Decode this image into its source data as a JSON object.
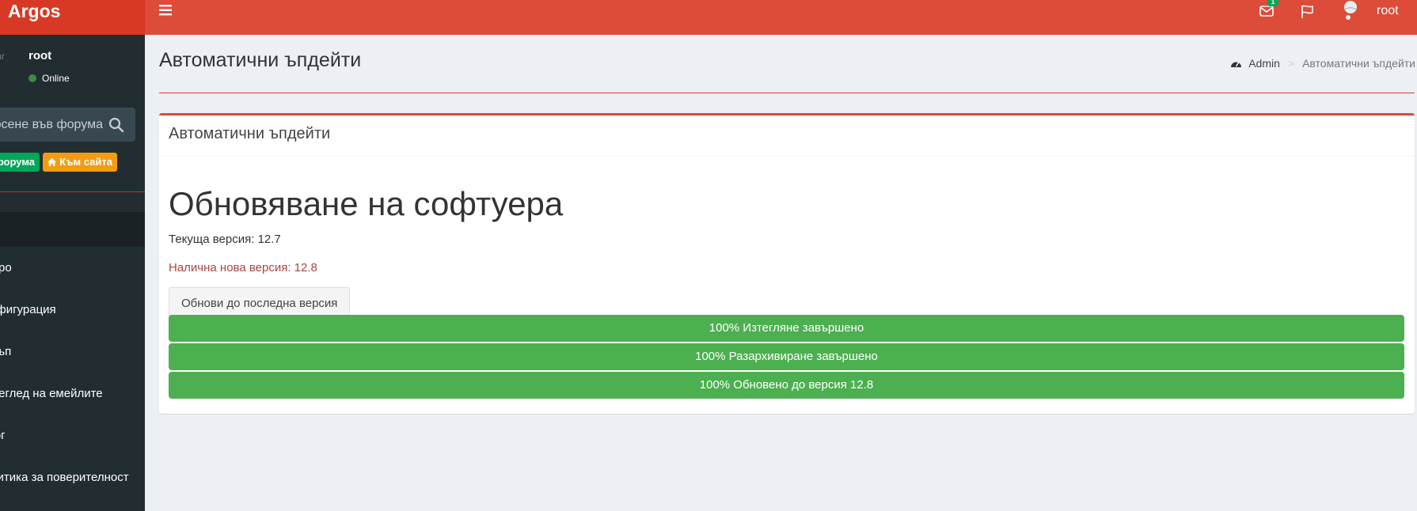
{
  "app": {
    "logo": "Argos"
  },
  "sidebar": {
    "user": {
      "name": "root",
      "status": "Online",
      "avatar_alt": "tar"
    },
    "search": {
      "placeholder": "Търсене във форума"
    },
    "buttons": {
      "forum_label": "Към форума",
      "site_label": "Към сайта"
    },
    "menu": [
      {
        "label": "ро"
      },
      {
        "label": "Конфигурация"
      },
      {
        "label": "Бекъп"
      },
      {
        "label": "Преглед на емейлите"
      },
      {
        "label": "Лог"
      },
      {
        "label": "Политика за поверителност"
      }
    ]
  },
  "navbar": {
    "mail_count": "1",
    "username": "root"
  },
  "page": {
    "title": "Автоматични ъпдейти",
    "breadcrumb": {
      "root": "Admin",
      "current": "Автоматични ъпдейти"
    }
  },
  "box": {
    "title": "Автоматични ъпдейти",
    "heading": "Обновяване на софтуера",
    "current_version": "Текуща версия: 12.7",
    "new_version": "Налична нова версия: 12.8",
    "update_button": "Обнови до последна версия",
    "progress": [
      {
        "percent": 100,
        "label": "100% Изтегляне завършено"
      },
      {
        "percent": 100,
        "label": "100% Разархивиране завършено"
      },
      {
        "percent": 100,
        "label": "100% Обновено до версия 12.8"
      }
    ]
  },
  "colors": {
    "brand": "#dd4b39",
    "sidebar": "#222d32",
    "success": "#4caf50",
    "warning": "#f39c12",
    "danger_text": "#a94442"
  }
}
